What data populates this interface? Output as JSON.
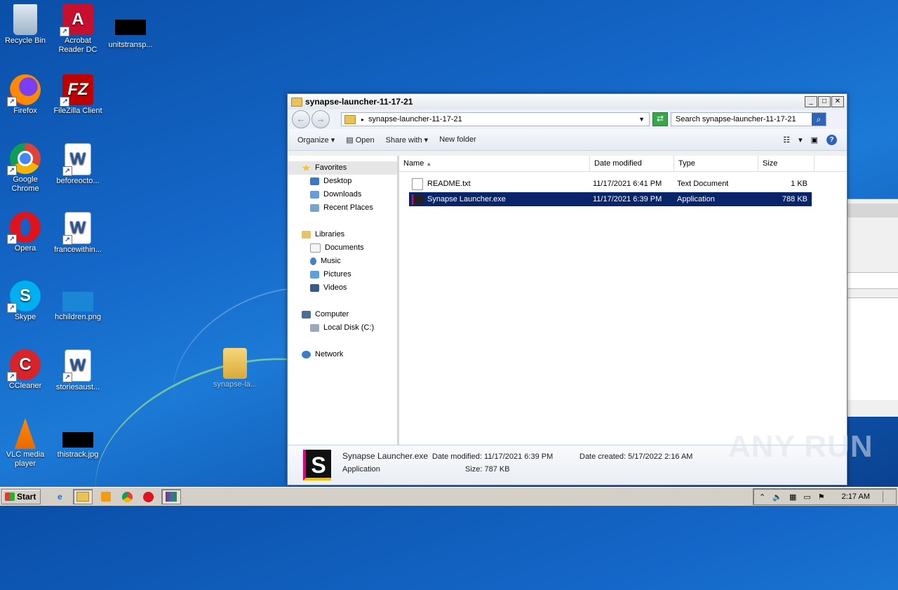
{
  "desktop": {
    "icons": [
      {
        "label": "Recycle Bin"
      },
      {
        "label": "Acrobat Reader DC"
      },
      {
        "label": "unitstransp..."
      },
      {
        "label": "Firefox"
      },
      {
        "label": "FileZilla Client"
      },
      {
        "label": "Google Chrome"
      },
      {
        "label": "beforeocto..."
      },
      {
        "label": "Opera"
      },
      {
        "label": "francewithin..."
      },
      {
        "label": "Skype"
      },
      {
        "label": "hchildren.png"
      },
      {
        "label": "CCleaner"
      },
      {
        "label": "storiesaust..."
      },
      {
        "label": "synapse-la..."
      },
      {
        "label": "VLC media player"
      },
      {
        "label": "thistrack.jpg"
      }
    ]
  },
  "window": {
    "title": "synapse-launcher-11-17-21",
    "controls": {
      "minimize": "_",
      "maximize": "□",
      "close": "✕"
    },
    "address": "synapse-launcher-11-17-21",
    "search_placeholder": "Search synapse-launcher-11-17-21",
    "toolbar": {
      "organize": "Organize",
      "open": "Open",
      "share_with": "Share with",
      "new_folder": "New folder"
    },
    "nav": {
      "favorites": "Favorites",
      "desktop": "Desktop",
      "downloads": "Downloads",
      "recent": "Recent Places",
      "libraries": "Libraries",
      "documents": "Documents",
      "music": "Music",
      "pictures": "Pictures",
      "videos": "Videos",
      "computer": "Computer",
      "local_disk": "Local Disk (C:)",
      "network": "Network"
    },
    "columns": {
      "name": "Name",
      "date": "Date modified",
      "type": "Type",
      "size": "Size"
    },
    "files": [
      {
        "name": "README.txt",
        "date": "11/17/2021 6:41 PM",
        "type": "Text Document",
        "size": "1 KB"
      },
      {
        "name": "Synapse Launcher.exe",
        "date": "11/17/2021 6:39 PM",
        "type": "Application",
        "size": "788 KB"
      }
    ],
    "details": {
      "name": "Synapse Launcher.exe",
      "kind": "Application",
      "modified": "Date modified: 11/17/2021 6:39 PM",
      "size": "Size: 787 KB",
      "created": "Date created: 5/17/2022 2:16 AM"
    }
  },
  "taskbar": {
    "start": "Start",
    "clock": "2:17 AM"
  },
  "watermark": "ANY RUN"
}
